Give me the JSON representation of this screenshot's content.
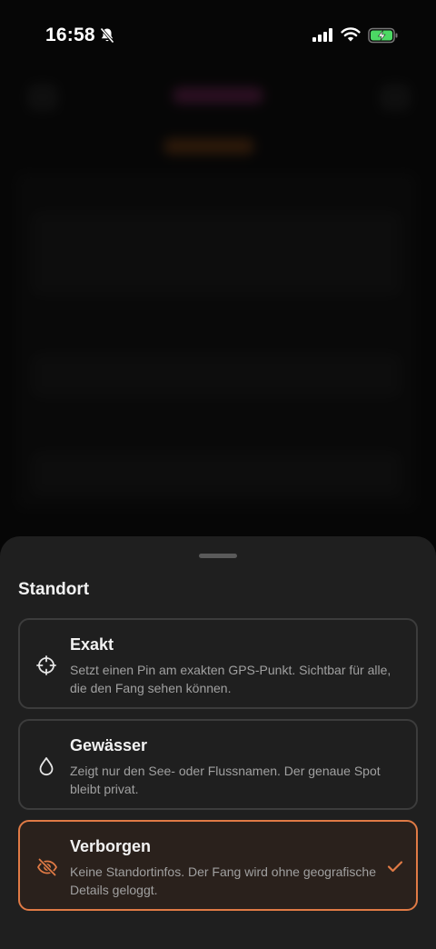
{
  "status_bar": {
    "time": "16:58",
    "icons": [
      "bell-slash-icon",
      "cellular-signal-icon",
      "wifi-icon",
      "battery-charging-icon"
    ]
  },
  "sheet": {
    "title": "Standort",
    "options": [
      {
        "label": "Exakt",
        "description": "Setzt einen Pin am exakten GPS-Punkt. Sichtbar für alle, die den Fang sehen können.",
        "icon": "crosshair-icon",
        "selected": false
      },
      {
        "label": "Gewässer",
        "description": "Zeigt nur den See- oder Flussnamen. Der genaue Spot bleibt privat.",
        "icon": "water-drop-icon",
        "selected": false
      },
      {
        "label": "Verborgen",
        "description": "Keine Standortinfos. Der Fang wird ohne geografische Details geloggt.",
        "icon": "eye-slash-icon",
        "selected": true
      }
    ]
  },
  "colors": {
    "accent": "#e07a45",
    "sheet_background": "#1f1f1f",
    "option_border": "#3c3c3c",
    "selected_background": "#2a211c",
    "description_text": "#a0a0a0",
    "battery_charging": "#4cd964"
  }
}
